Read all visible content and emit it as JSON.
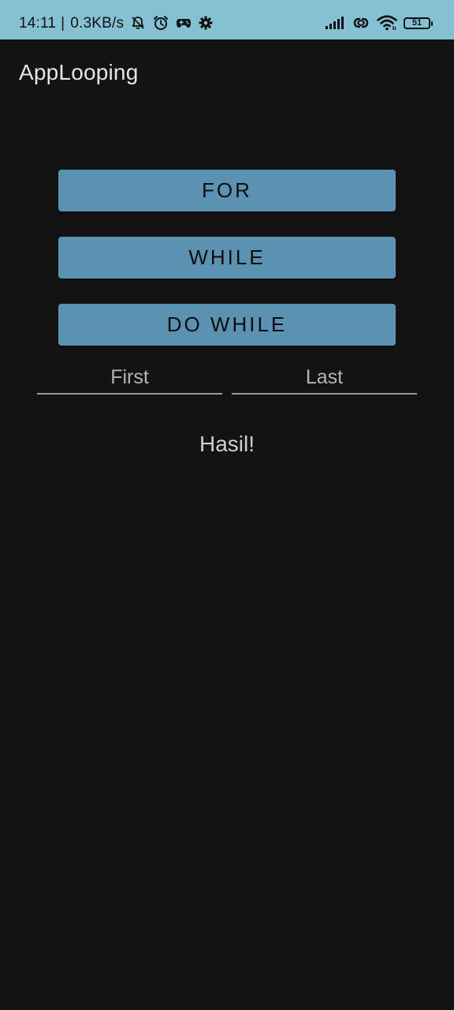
{
  "status_bar": {
    "time": "14:11",
    "separator": "|",
    "net_speed": "0.3KB/s",
    "icons_left": [
      "bell-off-icon",
      "alarm-icon",
      "game-controller-icon",
      "settings-gear-icon"
    ],
    "icons_right": [
      "signal-icon",
      "hotspot-link-icon",
      "wifi-icon"
    ],
    "battery_level": "51",
    "color": "#86c0d3"
  },
  "app_bar": {
    "title": "AppLooping"
  },
  "buttons": {
    "for_label": "FOR",
    "while_label": "WHILE",
    "do_while_label": "DO WHILE",
    "color": "#5b92b1"
  },
  "inputs": {
    "first_placeholder": "First",
    "last_placeholder": "Last"
  },
  "result": {
    "text": "Hasil!"
  },
  "colors": {
    "background": "#131313"
  }
}
